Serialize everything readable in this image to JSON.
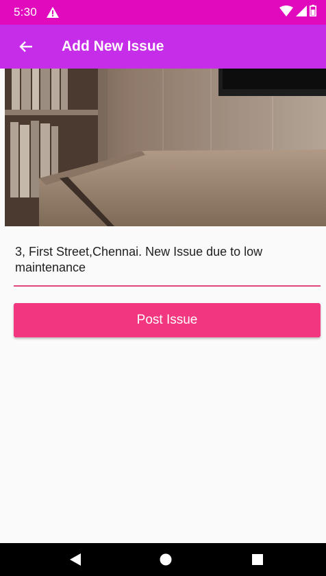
{
  "status_bar": {
    "time": "5:30",
    "colors": {
      "background": "#e10bbd"
    },
    "icons": [
      "warning-icon",
      "wifi-icon",
      "signal-icon",
      "battery-icon"
    ]
  },
  "app_bar": {
    "title": "Add New Issue",
    "back_icon": "arrow-back-icon",
    "colors": {
      "background": "#c52de9"
    }
  },
  "form": {
    "issue_text": "3, First Street,Chennai. New Issue due to low maintenance",
    "underline_color": "#e0457b",
    "post_button_label": "Post Issue",
    "post_button_color": "#f23680"
  },
  "nav_bar": {
    "icons": [
      "back-triangle-icon",
      "home-circle-icon",
      "recents-square-icon"
    ]
  }
}
